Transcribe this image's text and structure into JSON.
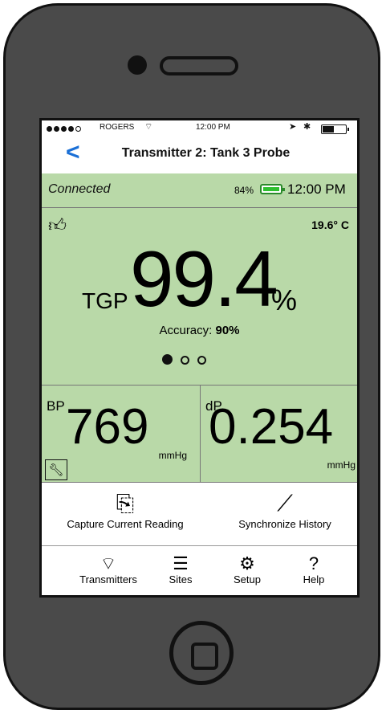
{
  "status_bar": {
    "carrier": "ROGERS",
    "time": "12:00 PM"
  },
  "nav": {
    "back_icon": "chevron-left-icon",
    "title": "Transmitter 2: Tank 3 Probe"
  },
  "connection": {
    "status": "Connected",
    "battery_percent": "84%",
    "time": "12:00 PM",
    "battery_color": "#2ec02e"
  },
  "reading": {
    "temperature": "19.6° C",
    "tgp_label": "TGP",
    "tgp_value": "99.4",
    "tgp_unit": "%",
    "accuracy_label": "Accuracy:",
    "accuracy_value": "90%",
    "page_indicator": {
      "total": 3,
      "active": 1
    }
  },
  "bp": {
    "label": "BP",
    "value": "769",
    "unit": "mmHg"
  },
  "dp": {
    "label": "dP",
    "value": "0.254",
    "unit": "mmHg"
  },
  "actions": {
    "capture": "Capture Current Reading",
    "sync": "Synchronize History"
  },
  "tabs": [
    {
      "label": "Transmitters",
      "icon": "wifi-icon"
    },
    {
      "label": "Sites",
      "icon": "list-icon"
    },
    {
      "label": "Setup",
      "icon": "gear-icon"
    },
    {
      "label": "Help",
      "icon": "question-icon"
    }
  ],
  "colors": {
    "panel_green": "#b9d9a8",
    "accent_blue": "#1a6fd6"
  }
}
